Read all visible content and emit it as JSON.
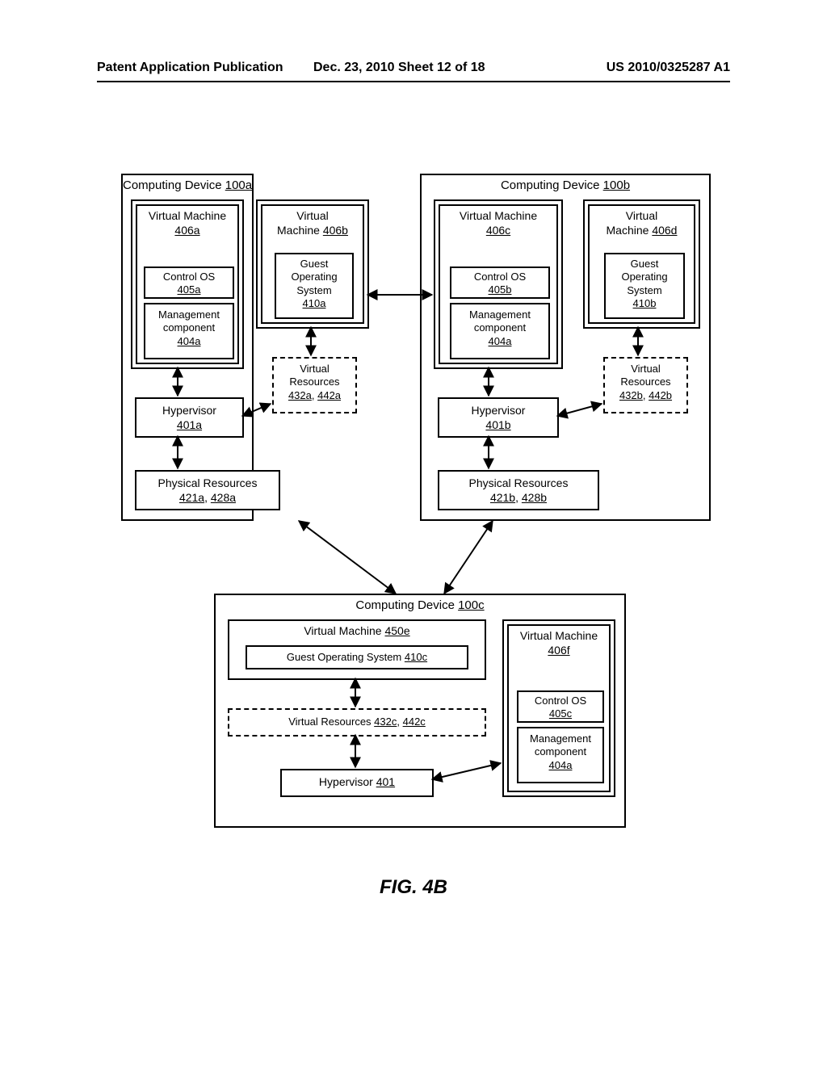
{
  "header": {
    "left": "Patent Application Publication",
    "mid": "Dec. 23, 2010  Sheet 12 of 18",
    "right": "US 2010/0325287 A1"
  },
  "figCaption": "FIG. 4B",
  "devA": {
    "title_pre": "Computing Device ",
    "title_ref": "100a",
    "vm1_pre": "Virtual Machine",
    "vm1_ref": "406a",
    "vm2_pre": "Virtual",
    "vm2_pre2": "Machine ",
    "vm2_ref": "406b",
    "ctrl_pre": "Control OS",
    "ctrl_ref": "405a",
    "mgmt_pre": "Management",
    "mgmt_pre2": "component",
    "mgmt_ref": "404a",
    "guest_pre": "Guest",
    "guest_pre2": "Operating",
    "guest_pre3": "System",
    "guest_ref": "410a",
    "vres_pre": "Virtual",
    "vres_pre2": "Resources",
    "vres_ref1": "432a",
    "vres_sep": ", ",
    "vres_ref2": "442a",
    "hyp_pre": "Hypervisor",
    "hyp_ref": "401a",
    "phys_pre": "Physical Resources",
    "phys_ref1": "421a",
    "phys_sep": ", ",
    "phys_ref2": "428a"
  },
  "devB": {
    "title_pre": "Computing Device ",
    "title_ref": "100b",
    "vm1_pre": "Virtual Machine",
    "vm1_ref": "406c",
    "vm2_pre": "Virtual",
    "vm2_pre2": "Machine ",
    "vm2_ref": "406d",
    "ctrl_pre": "Control OS",
    "ctrl_ref": "405b",
    "mgmt_pre": "Management",
    "mgmt_pre2": "component",
    "mgmt_ref": "404a",
    "guest_pre": "Guest",
    "guest_pre2": "Operating",
    "guest_pre3": "System",
    "guest_ref": "410b",
    "vres_pre": "Virtual",
    "vres_pre2": "Resources",
    "vres_ref1": "432b",
    "vres_sep": ", ",
    "vres_ref2": "442b",
    "hyp_pre": "Hypervisor",
    "hyp_ref": "401b",
    "phys_pre": "Physical Resources",
    "phys_ref1": "421b",
    "phys_sep": ", ",
    "phys_ref2": "428b"
  },
  "devC": {
    "title_pre": "Computing Device ",
    "title_ref": "100c",
    "vm1_pre": "Virtual Machine ",
    "vm1_ref": "450e",
    "gos_pre": "Guest Operating System ",
    "gos_ref": "410c",
    "vres_pre": "Virtual Resources ",
    "vres_ref1": "432c",
    "vres_sep": ", ",
    "vres_ref2": "442c",
    "hyp_pre": "Hypervisor ",
    "hyp_ref": "401",
    "vm2_pre": "Virtual Machine",
    "vm2_ref": "406f",
    "ctrl_pre": "Control OS",
    "ctrl_ref": "405c",
    "mgmt_pre": "Management",
    "mgmt_pre2": "component",
    "mgmt_ref": "404a"
  }
}
